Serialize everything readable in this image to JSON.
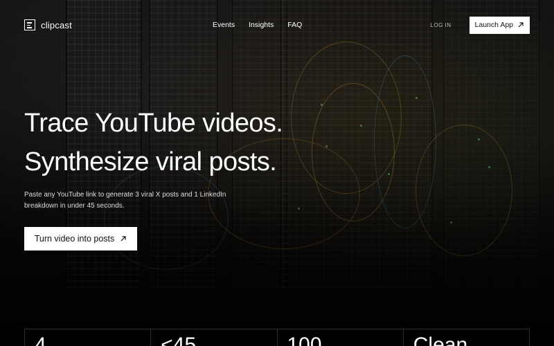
{
  "brand": {
    "name": "clipcast"
  },
  "nav": {
    "items": [
      "Events",
      "Insights",
      "FAQ"
    ]
  },
  "auth": {
    "login_label": "LOG IN",
    "launch_label": "Launch App"
  },
  "hero": {
    "line1": "Trace YouTube videos.",
    "line2": "Synthesize viral posts.",
    "subtitle": "Paste any YouTube link to generate 3 viral X posts and 1 LinkedIn breakdown in under 45 seconds.",
    "cta_label": "Turn video into posts"
  },
  "stats": {
    "values": [
      "4",
      "<45",
      "100",
      "Clean"
    ]
  },
  "colors": {
    "background": "#0b0b0b",
    "button_bg": "#ffffff",
    "button_text": "#111111"
  },
  "icons": {
    "logo": "document-lines-icon",
    "arrow": "arrow-up-right-icon"
  }
}
